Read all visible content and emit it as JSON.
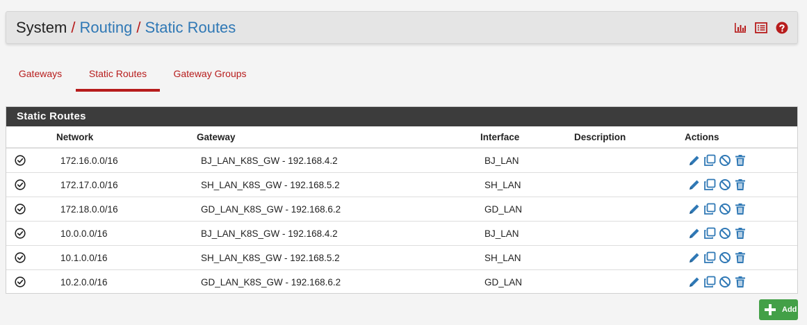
{
  "breadcrumb": {
    "item1": "System",
    "sep": "/",
    "item2": "Routing",
    "item3": "Static Routes"
  },
  "header_icons": [
    "chart-icon",
    "list-icon",
    "help-icon"
  ],
  "tabs": [
    {
      "label": "Gateways",
      "active": false
    },
    {
      "label": "Static Routes",
      "active": true
    },
    {
      "label": "Gateway Groups",
      "active": false
    }
  ],
  "panel": {
    "title": "Static Routes",
    "columns": [
      "",
      "Network",
      "Gateway",
      "Interface",
      "Description",
      "Actions"
    ],
    "rows": [
      {
        "network": "172.16.0.0/16",
        "gateway": "BJ_LAN_K8S_GW - 192.168.4.2",
        "interface": "BJ_LAN",
        "description": ""
      },
      {
        "network": "172.17.0.0/16",
        "gateway": "SH_LAN_K8S_GW - 192.168.5.2",
        "interface": "SH_LAN",
        "description": ""
      },
      {
        "network": "172.18.0.0/16",
        "gateway": "GD_LAN_K8S_GW - 192.168.6.2",
        "interface": "GD_LAN",
        "description": ""
      },
      {
        "network": "10.0.0.0/16",
        "gateway": "BJ_LAN_K8S_GW - 192.168.4.2",
        "interface": "BJ_LAN",
        "description": ""
      },
      {
        "network": "10.1.0.0/16",
        "gateway": "SH_LAN_K8S_GW - 192.168.5.2",
        "interface": "SH_LAN",
        "description": ""
      },
      {
        "network": "10.2.0.0/16",
        "gateway": "GD_LAN_K8S_GW - 192.168.6.2",
        "interface": "GD_LAN",
        "description": ""
      }
    ]
  },
  "add_button": {
    "label": "Add"
  },
  "colors": {
    "accent": "#b71c1c",
    "link": "#2f78b5",
    "add": "#43a047",
    "panel_heading": "#3c3c3c"
  }
}
